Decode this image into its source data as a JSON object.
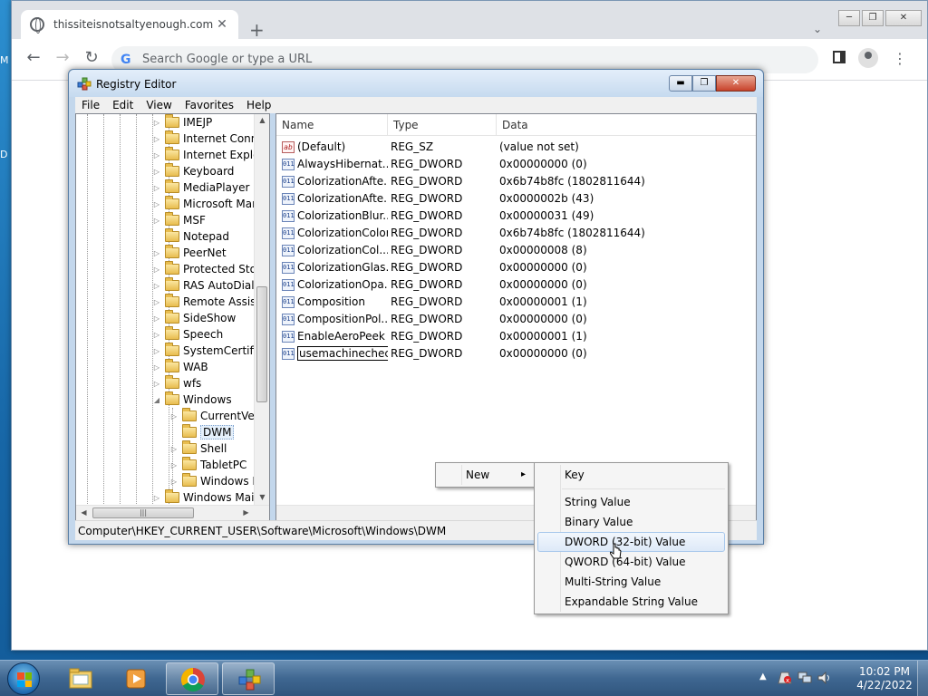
{
  "browser": {
    "tab_title": "thissiteisnotsaltyenough.com",
    "tab_close": "✕",
    "new_tab": "+",
    "tab_search": "⌄",
    "address_placeholder": "Search Google or type a URL",
    "google_icon": "G",
    "back": "←",
    "forward": "→",
    "reload": "↻",
    "menu": "⋮",
    "win_min": "─",
    "win_restore": "❐",
    "win_close": "✕"
  },
  "desktop_peek": [
    "M",
    "D"
  ],
  "regedit": {
    "title": "Registry Editor",
    "menu": [
      "File",
      "Edit",
      "View",
      "Favorites",
      "Help"
    ],
    "buttons": {
      "min": "▬",
      "max": "❐",
      "close": "✕"
    },
    "tree": [
      {
        "label": "IMEJP",
        "level": 1,
        "expander": "▷"
      },
      {
        "label": "Internet Conne",
        "level": 1,
        "expander": "▷"
      },
      {
        "label": "Internet Explor",
        "level": 1,
        "expander": "▷"
      },
      {
        "label": "Keyboard",
        "level": 1,
        "expander": "▷"
      },
      {
        "label": "MediaPlayer",
        "level": 1,
        "expander": "▷"
      },
      {
        "label": "Microsoft Mar",
        "level": 1,
        "expander": "▷"
      },
      {
        "label": "MSF",
        "level": 1,
        "expander": "▷"
      },
      {
        "label": "Notepad",
        "level": 1,
        "expander": ""
      },
      {
        "label": "PeerNet",
        "level": 1,
        "expander": "▷"
      },
      {
        "label": "Protected Stor",
        "level": 1,
        "expander": "▷"
      },
      {
        "label": "RAS AutoDial",
        "level": 1,
        "expander": "▷"
      },
      {
        "label": "Remote Assista",
        "level": 1,
        "expander": "▷"
      },
      {
        "label": "SideShow",
        "level": 1,
        "expander": "▷"
      },
      {
        "label": "Speech",
        "level": 1,
        "expander": "▷"
      },
      {
        "label": "SystemCertific",
        "level": 1,
        "expander": "▷"
      },
      {
        "label": "WAB",
        "level": 1,
        "expander": "▷"
      },
      {
        "label": "wfs",
        "level": 1,
        "expander": "▷"
      },
      {
        "label": "Windows",
        "level": 1,
        "expander": "◢"
      },
      {
        "label": "CurrentVer",
        "level": 2,
        "expander": "▷"
      },
      {
        "label": "DWM",
        "level": 2,
        "expander": "",
        "selected": true
      },
      {
        "label": "Shell",
        "level": 2,
        "expander": "▷"
      },
      {
        "label": "TabletPC",
        "level": 2,
        "expander": "▷"
      },
      {
        "label": "Windows E",
        "level": 2,
        "expander": "▷"
      },
      {
        "label": "Windows Mail",
        "level": 1,
        "expander": "▷"
      }
    ],
    "tree_scroll": {
      "up": "▲",
      "down": "▼",
      "left": "◀",
      "right": "▶",
      "grip": "|||"
    },
    "columns": [
      "Name",
      "Type",
      "Data"
    ],
    "values": [
      {
        "name": "(Default)",
        "type": "REG_SZ",
        "data": "(value not set)",
        "icon": "ab"
      },
      {
        "name": "AlwaysHibernat...",
        "type": "REG_DWORD",
        "data": "0x00000000 (0)",
        "icon": "011"
      },
      {
        "name": "ColorizationAfte...",
        "type": "REG_DWORD",
        "data": "0x6b74b8fc (1802811644)",
        "icon": "011"
      },
      {
        "name": "ColorizationAfte...",
        "type": "REG_DWORD",
        "data": "0x0000002b (43)",
        "icon": "011"
      },
      {
        "name": "ColorizationBlur...",
        "type": "REG_DWORD",
        "data": "0x00000031 (49)",
        "icon": "011"
      },
      {
        "name": "ColorizationColor",
        "type": "REG_DWORD",
        "data": "0x6b74b8fc (1802811644)",
        "icon": "011"
      },
      {
        "name": "ColorizationCol...",
        "type": "REG_DWORD",
        "data": "0x00000008 (8)",
        "icon": "011"
      },
      {
        "name": "ColorizationGlas...",
        "type": "REG_DWORD",
        "data": "0x00000000 (0)",
        "icon": "011"
      },
      {
        "name": "ColorizationOpa...",
        "type": "REG_DWORD",
        "data": "0x00000000 (0)",
        "icon": "011"
      },
      {
        "name": "Composition",
        "type": "REG_DWORD",
        "data": "0x00000001 (1)",
        "icon": "011"
      },
      {
        "name": "CompositionPol...",
        "type": "REG_DWORD",
        "data": "0x00000000 (0)",
        "icon": "011"
      },
      {
        "name": "EnableAeroPeek",
        "type": "REG_DWORD",
        "data": "0x00000001 (1)",
        "icon": "011"
      },
      {
        "name": "usemachinecheck",
        "type": "REG_DWORD",
        "data": "0x00000000 (0)",
        "icon": "011",
        "editing": true
      }
    ],
    "status_path": "Computer\\HKEY_CURRENT_USER\\Software\\Microsoft\\Windows\\DWM"
  },
  "context_menu": {
    "new_label": "New",
    "submenu_arrow": "▸",
    "submenu": [
      "Key",
      "String Value",
      "Binary Value",
      "DWORD (32-bit) Value",
      "QWORD (64-bit) Value",
      "Multi-String Value",
      "Expandable String Value"
    ],
    "hovered": "DWORD (32-bit) Value"
  },
  "taskbar": {
    "time": "10:02 PM",
    "date": "4/22/2022",
    "tray_arrow": "▲",
    "apps": [
      "explorer-icon",
      "media-player-icon",
      "chrome-icon",
      "regedit-icon"
    ],
    "active_app": "chrome-icon"
  }
}
